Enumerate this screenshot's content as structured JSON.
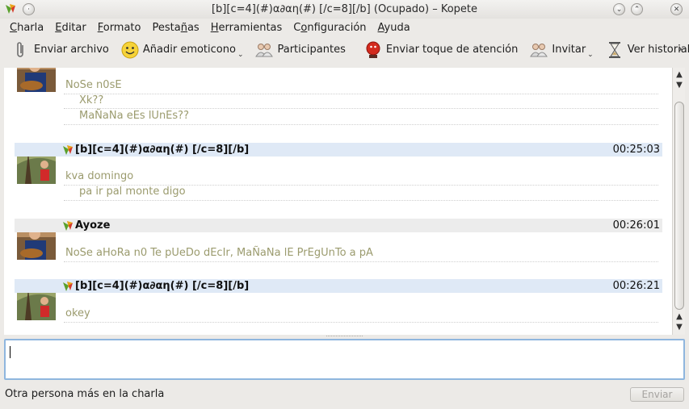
{
  "window": {
    "title": "[b][c=4](#)α∂αη(#) [/c=8][/b] (Ocupado) – Kopete"
  },
  "menu": [
    {
      "label": "Charla",
      "ul": "C",
      "rest": "harla"
    },
    {
      "label": "Editar",
      "ul": "E",
      "rest": "ditar"
    },
    {
      "label": "Formato",
      "ul": "F",
      "rest": "ormato"
    },
    {
      "label": "Pestañas",
      "pre": "Pesta",
      "ul": "ñ",
      "rest": "as"
    },
    {
      "label": "Herramientas",
      "ul": "H",
      "rest": "erramientas"
    },
    {
      "label": "Configuración",
      "pre": "C",
      "ul": "o",
      "rest": "nfiguración"
    },
    {
      "label": "Ayuda",
      "ul": "A",
      "rest": "yuda"
    }
  ],
  "toolbar": {
    "send_file": "Enviar archivo",
    "add_emoticon": "Añadir emoticono",
    "participants": "Participantes",
    "nudge": "Enviar toque de atención",
    "invite": "Invitar",
    "history": "Ver historial"
  },
  "messages": [
    {
      "lines": [
        "NoSe n0sE",
        "Xk??",
        "MaÑaNa eEs lUnEs??"
      ]
    },
    {
      "name": "[b][c=4](#)α∂αη(#) [/c=8][/b]",
      "time": "00:25:03",
      "lines": [
        "kva domingo",
        "pa ir pal monte digo"
      ]
    },
    {
      "name": "Ayoze",
      "time": "00:26:01",
      "lines": [
        "NoSe aHoRa n0 Te pUeDo dEcIr, MaÑaNa lE PrEgUnTo a pA"
      ]
    },
    {
      "name": "[b][c=4](#)α∂αη(#) [/c=8][/b]",
      "time": "00:26:21",
      "lines": [
        "okey"
      ]
    }
  ],
  "input": {
    "value": ""
  },
  "status": {
    "text": "Otra persona más en la charla",
    "send_label": "Enviar"
  },
  "colors": {
    "self_header": "#dfe9f6",
    "other_header": "#ececec",
    "message_text": "#9b9b6e",
    "input_border": "#8fb6de"
  }
}
